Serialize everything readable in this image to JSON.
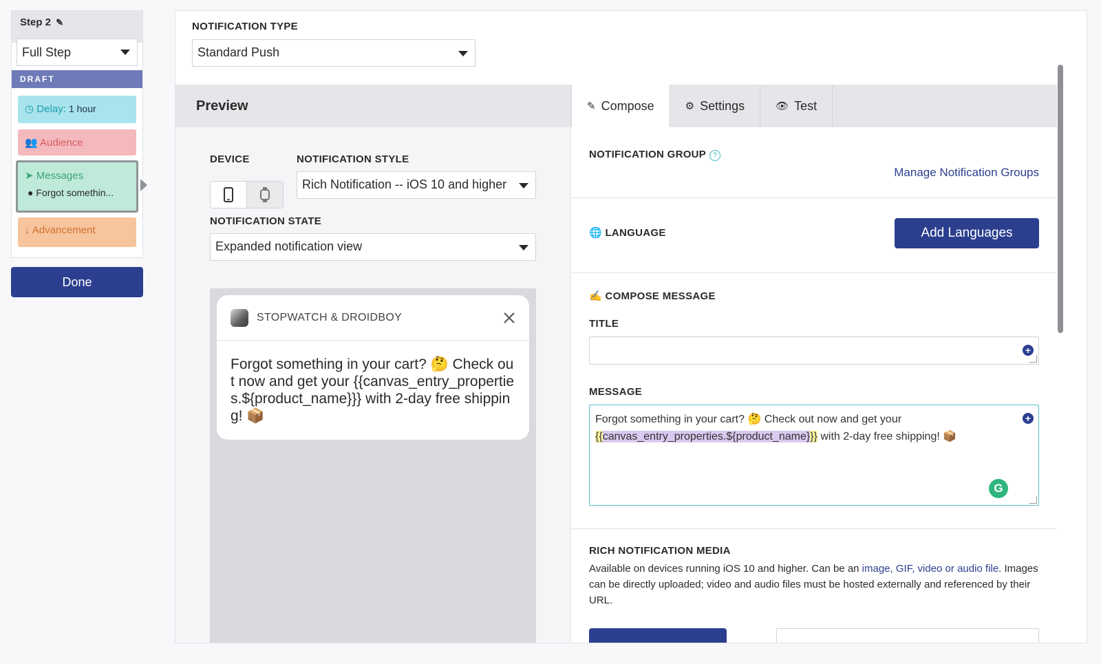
{
  "step_panel": {
    "title": "Step 2",
    "mode_select": "Full Step",
    "status": "DRAFT",
    "components": {
      "delay_label": "Delay:",
      "delay_value": "1 hour",
      "audience": "Audience",
      "messages": "Messages",
      "message_item": "Forgot somethin...",
      "advancement": "Advancement"
    },
    "done_label": "Done"
  },
  "notification_type": {
    "label": "NOTIFICATION TYPE",
    "value": "Standard Push"
  },
  "preview": {
    "title": "Preview",
    "device_label": "DEVICE",
    "style_label": "NOTIFICATION STYLE",
    "style_value": "Rich Notification -- iOS 10 and higher",
    "state_label": "NOTIFICATION STATE",
    "state_value": "Expanded notification view",
    "notification": {
      "app_name": "STOPWATCH & DROIDBOY",
      "body": "Forgot something in your cart? 🤔 Check out now and get your {{canvas_entry_properties.${product_name}}} with 2-day free shipping! 📦"
    }
  },
  "tabs": [
    {
      "label": "Compose",
      "icon": "pencil-icon"
    },
    {
      "label": "Settings",
      "icon": "gear-icon"
    },
    {
      "label": "Test",
      "icon": "eye-icon"
    }
  ],
  "compose": {
    "group_label": "NOTIFICATION GROUP",
    "manage_groups_link": "Manage Notification Groups",
    "language_label": "LANGUAGE",
    "add_languages_label": "Add Languages",
    "compose_message_label": "COMPOSE MESSAGE",
    "title_label": "TITLE",
    "title_value": "",
    "message_label": "MESSAGE",
    "message_part1": "Forgot something in your cart? 🤔 Check out now and get your",
    "message_brace_open": "{{",
    "message_liquid": "canvas_entry_properties.${product_name}",
    "message_brace_close": "}}",
    "message_part2": " with 2-day free shipping! 📦",
    "media_label": "RICH NOTIFICATION MEDIA",
    "media_text_1": "Available on devices running iOS 10 and higher. Can be an ",
    "media_link": "image, GIF, video or audio file",
    "media_text_2": ". Images can be directly uploaded; video and audio files must be hosted externally and referenced by their URL."
  },
  "colors": {
    "brand": "#2c3f8f",
    "delay": "#a9e4ec",
    "audience": "#f4b9bc",
    "messages": "#bfe9d9",
    "advancement": "#f6c49d"
  }
}
